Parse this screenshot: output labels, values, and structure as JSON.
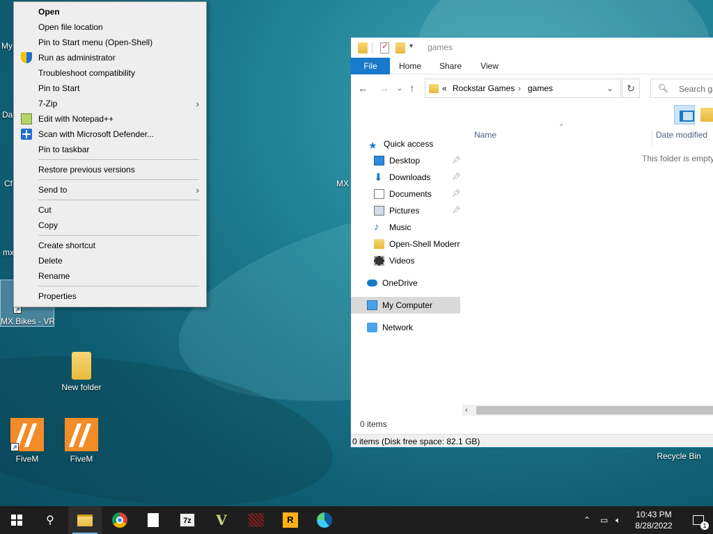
{
  "desktop": {
    "icons": [
      {
        "label": "New folder"
      },
      {
        "label": "FiveM"
      },
      {
        "label": "FiveM"
      },
      {
        "label": "MX Bikes - VR"
      },
      {
        "label": "Recycle Bin"
      }
    ],
    "partial_labels": [
      "My Ca",
      "Dat",
      "Cf",
      "mx",
      "MX"
    ]
  },
  "context_menu": {
    "items": [
      {
        "label": "Open",
        "bold": true
      },
      {
        "label": "Open file location"
      },
      {
        "label": "Pin to Start menu (Open-Shell)"
      },
      {
        "label": "Run as administrator",
        "icon": "uac-shield-icon"
      },
      {
        "label": "Troubleshoot compatibility"
      },
      {
        "label": "Pin to Start"
      },
      {
        "label": "7-Zip",
        "submenu": true
      },
      {
        "label": "Edit with Notepad++",
        "icon": "notepad-plus-plus-icon"
      },
      {
        "label": "Scan with Microsoft Defender...",
        "icon": "defender-icon"
      },
      {
        "label": "Pin to taskbar"
      },
      {
        "label": "Restore previous versions"
      },
      {
        "label": "Send to",
        "submenu": true
      },
      {
        "label": "Cut"
      },
      {
        "label": "Copy"
      },
      {
        "label": "Create shortcut"
      },
      {
        "label": "Delete"
      },
      {
        "label": "Rename"
      },
      {
        "label": "Properties"
      }
    ]
  },
  "explorer": {
    "title": "games",
    "ribbon_tabs": [
      "File",
      "Home",
      "Share",
      "View"
    ],
    "address": {
      "prefix": "«",
      "crumbs": [
        "Rockstar Games",
        "games"
      ]
    },
    "search_placeholder": "Search ga",
    "nav": {
      "quick_access": "Quick access",
      "items": [
        {
          "label": "Desktop",
          "pinned": true
        },
        {
          "label": "Downloads",
          "pinned": true
        },
        {
          "label": "Documents",
          "pinned": true
        },
        {
          "label": "Pictures",
          "pinned": true
        },
        {
          "label": "Music"
        },
        {
          "label": "Open-Shell Modern"
        },
        {
          "label": "Videos"
        }
      ],
      "onedrive": "OneDrive",
      "my_computer": "My Computer",
      "network": "Network"
    },
    "columns": {
      "name": "Name",
      "date_modified": "Date modified"
    },
    "empty_message": "This folder is empty.",
    "items_count": "0 items",
    "status": "0 items (Disk free space: 82.1 GB)"
  },
  "taskbar": {
    "clock_time": "10:43 PM",
    "clock_date": "8/28/2022",
    "notification_count": "1",
    "seven_zip": "7z",
    "rockstar": "R"
  },
  "colors": {
    "accent": "#1979ca",
    "taskbar": "#1e1e1e"
  }
}
